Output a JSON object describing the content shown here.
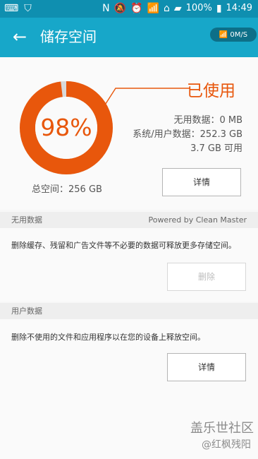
{
  "statusbar": {
    "battery": "100%",
    "time": "14:49"
  },
  "appbar": {
    "title": "储存空间",
    "network_speed": "0M/S"
  },
  "storage": {
    "percent_text": "98%",
    "used_label": "已使用",
    "unused_text": "无用数据：0 MB",
    "system_user_text": "系统/用户数据：252.3 GB",
    "available_text": "3.7 GB 可用",
    "total_text": "总空间：256 GB",
    "details_button": "详情",
    "used_fraction": 0.98
  },
  "junk_section": {
    "title": "无用数据",
    "powered_by": "Powered by Clean Master",
    "description": "删除缓存、残留和广告文件等不必要的数据可释放更多存储空间。",
    "button": "删除"
  },
  "user_section": {
    "title": "用户数据",
    "description": "删除不使用的文件和应用程序以在您的设备上释放空间。",
    "button": "详情"
  },
  "watermark": {
    "title": "盖乐世社区",
    "author": "@红枫残阳"
  },
  "colors": {
    "header": "#17a7c9",
    "statusbar": "#0f8fb0",
    "accent": "#e8570c"
  },
  "icons": {
    "back": "back-arrow-icon",
    "wifi": "wifi-icon",
    "battery": "battery-icon",
    "alarm": "alarm-icon"
  }
}
